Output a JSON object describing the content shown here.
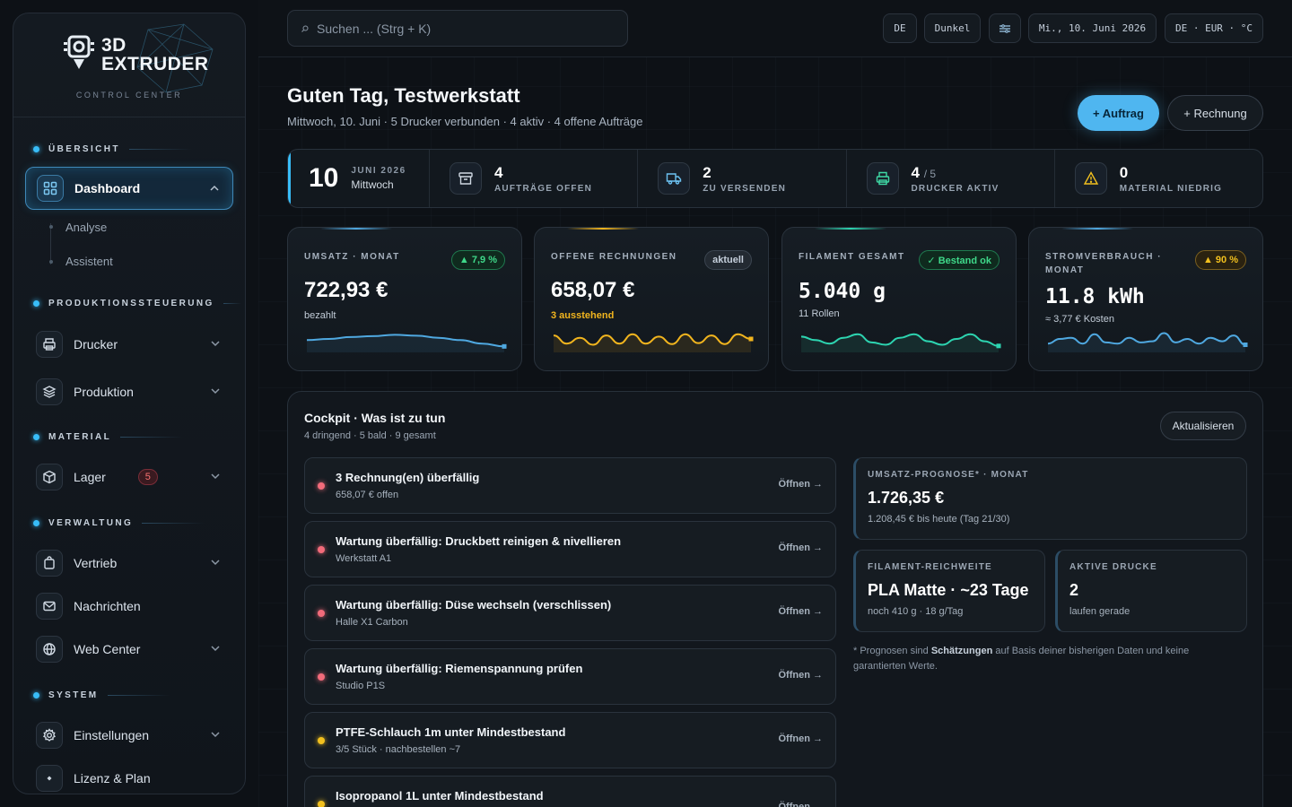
{
  "brand": {
    "line1": "3D",
    "line2": "EXTRUDER",
    "subtitle": "CONTROL CENTER"
  },
  "sidebar": {
    "sections": {
      "overview": "ÜBERSICHT",
      "production": "PRODUKTIONSSTEUERUNG",
      "material": "MATERIAL",
      "admin": "VERWALTUNG",
      "system": "SYSTEM"
    },
    "items": {
      "dashboard": "Dashboard",
      "analysis": "Analyse",
      "assistant": "Assistent",
      "printers": "Drucker",
      "production": "Produktion",
      "storage": "Lager",
      "storage_badge": "5",
      "sales": "Vertrieb",
      "messages": "Nachrichten",
      "webcenter": "Web Center",
      "settings": "Einstellungen",
      "license": "Lizenz & Plan"
    }
  },
  "topbar": {
    "search_placeholder": "Suchen ... (Strg + K)",
    "lang": "DE",
    "theme": "Dunkel",
    "date": "Mi., 10. Juni 2026",
    "locale": "DE · EUR · °C"
  },
  "greeting": {
    "title": "Guten Tag, Testwerkstatt",
    "subtitle": "Mittwoch, 10. Juni · 5 Drucker verbunden · 4 aktiv · 4 offene Aufträge",
    "btn_order": "+ Auftrag",
    "btn_invoice": "+ Rechnung"
  },
  "strip": {
    "day": "10",
    "month": "JUNI 2026",
    "weekday": "Mittwoch",
    "orders_num": "4",
    "orders_label": "AUFTRÄGE OFFEN",
    "ship_num": "2",
    "ship_label": "ZU VERSENDEN",
    "printers_num": "4",
    "printers_total": "/ 5",
    "printers_label": "DRUCKER AKTIV",
    "material_num": "0",
    "material_label": "MATERIAL NIEDRIG"
  },
  "kpis": [
    {
      "label": "UMSATZ · MONAT",
      "badge": "▲ 7,9 %",
      "value": "722,93 €",
      "sub": "bezahlt",
      "color": "#4fa8e0",
      "spark": [
        0.55,
        0.5,
        0.42,
        0.38,
        0.32,
        0.36,
        0.45,
        0.55,
        0.7,
        0.82
      ]
    },
    {
      "label": "OFFENE RECHNUNGEN",
      "badge": "aktuell",
      "value": "658,07 €",
      "sub": "3 ausstehend",
      "color": "#f2b51e",
      "spark": [
        0.35,
        0.7,
        0.45,
        0.75,
        0.35,
        0.7,
        0.3,
        0.7,
        0.4,
        0.72,
        0.3,
        0.68,
        0.35,
        0.72,
        0.3,
        0.5
      ]
    },
    {
      "label": "FILAMENT GESAMT",
      "badge": "✓ Bestand ok",
      "value": "5.040 g",
      "sub": "11 Rollen",
      "color": "#2dd4b0",
      "spark": [
        0.4,
        0.55,
        0.7,
        0.45,
        0.3,
        0.65,
        0.75,
        0.45,
        0.3,
        0.6,
        0.75,
        0.5,
        0.3,
        0.6,
        0.8
      ]
    },
    {
      "label": "STROMVERBRAUCH · MONAT",
      "badge": "▲ 90 %",
      "value": "11.8 kWh",
      "sub": "≈ 3,77 € Kosten",
      "color": "#4fa8e0",
      "spark": [
        0.7,
        0.5,
        0.45,
        0.7,
        0.3,
        0.65,
        0.7,
        0.45,
        0.65,
        0.6,
        0.25,
        0.65,
        0.5,
        0.7,
        0.45,
        0.6,
        0.35,
        0.75
      ]
    }
  ],
  "cockpit": {
    "title": "Cockpit · Was ist zu tun",
    "subtitle": "4 dringend · 5 bald · 9 gesamt",
    "refresh": "Aktualisieren",
    "open_label": "Öffnen →",
    "tasks": [
      {
        "title": "3 Rechnung(en) überfällig",
        "sub": "658,07 € offen",
        "color": "#f26b7a"
      },
      {
        "title": "Wartung überfällig: Druckbett reinigen & nivellieren",
        "sub": "Werkstatt A1",
        "color": "#f26b7a"
      },
      {
        "title": "Wartung überfällig: Düse wechseln (verschlissen)",
        "sub": "Halle X1 Carbon",
        "color": "#f26b7a"
      },
      {
        "title": "Wartung überfällig: Riemenspannung prüfen",
        "sub": "Studio P1S",
        "color": "#f26b7a"
      },
      {
        "title": "PTFE-Schlauch 1m unter Mindestbestand",
        "sub": "3/5 Stück · nachbestellen ~7",
        "color": "#f2c01e"
      },
      {
        "title": "Isopropanol 1L unter Mindestbestand",
        "sub": "",
        "color": "#f2c01e"
      }
    ],
    "forecast": {
      "label": "UMSATZ-PROGNOSE* · MONAT",
      "value": "1.726,35 €",
      "sub": "1.208,45 € bis heute (Tag 21/30)"
    },
    "filament": {
      "label": "FILAMENT-REICHWEITE",
      "value": "PLA Matte · ~23 Tage",
      "sub": "noch 410 g · 18 g/Tag"
    },
    "active": {
      "label": "AKTIVE DRUCKE",
      "value": "2",
      "sub": "laufen gerade"
    },
    "note_pre": "* Prognosen sind ",
    "note_bold": "Schätzungen",
    "note_post": " auf Basis deiner bisherigen Daten und keine garantierten Werte."
  }
}
